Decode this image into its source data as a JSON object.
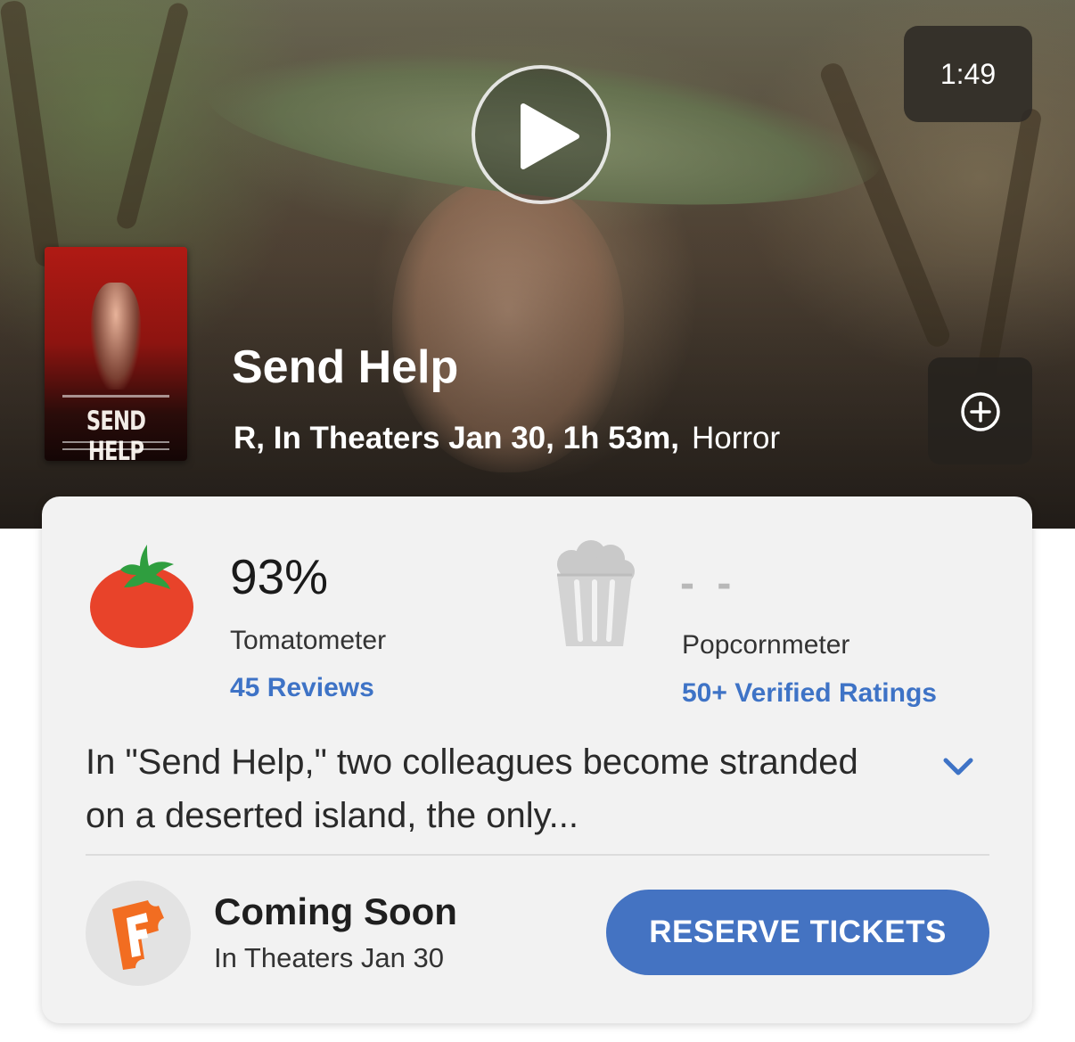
{
  "hero": {
    "duration": "1:49",
    "poster_title": "SEND HELP",
    "title": "Send Help",
    "meta_details": "R, In Theaters Jan 30, 1h 53m,",
    "genre": "Horror"
  },
  "scores": {
    "tomatometer": {
      "value": "93%",
      "label": "Tomatometer",
      "reviews": "45 Reviews"
    },
    "popcornmeter": {
      "value": "- -",
      "label": "Popcornmeter",
      "ratings": "50+ Verified Ratings"
    }
  },
  "synopsis": "In \"Send Help,\" two colleagues become stranded on a deserted island, the only...",
  "tickets": {
    "status": "Coming Soon",
    "date": "In Theaters Jan 30",
    "button_label": "RESERVE TICKETS"
  },
  "colors": {
    "accent_blue": "#4473c2",
    "link_blue": "#3e73c6",
    "tomato_red": "#e8432a",
    "fandango_orange": "#f26d21"
  },
  "icons": [
    "play-icon",
    "add-circle-icon",
    "tomato-icon",
    "popcorn-icon",
    "chevron-down-icon",
    "fandango-logo-icon"
  ]
}
